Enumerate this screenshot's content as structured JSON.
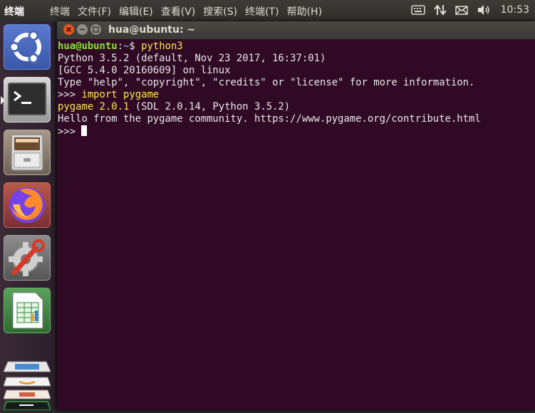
{
  "topbar": {
    "app_name": "终端",
    "menus": [
      "终端",
      "文件(F)",
      "编辑(E)",
      "查看(V)",
      "搜索(S)",
      "终端(T)",
      "帮助(H)"
    ],
    "indicators": [
      "keyboard-icon",
      "network-updown-icon",
      "mail-icon",
      "volume-icon"
    ],
    "clock": "10:53"
  },
  "launcher": {
    "items": [
      "ubuntu-dash",
      "terminal",
      "file-manager",
      "firefox",
      "system-settings",
      "libreoffice-calc",
      "stacked-apps"
    ]
  },
  "window": {
    "title": "hua@ubuntu: ~",
    "buttons": [
      "close",
      "minimize",
      "maximize"
    ]
  },
  "terminal": {
    "prompt_user": "hua@ubuntu",
    "prompt_sep": ":",
    "prompt_path": "~",
    "prompt_dollar": "$ ",
    "command": "python3",
    "line1": "Python 3.5.2 (default, Nov 23 2017, 16:37:01)",
    "line2": "[GCC 5.4.0 20160609] on linux",
    "line3": "Type \"help\", \"copyright\", \"credits\" or \"license\" for more information.",
    "repl_prompt": ">>> ",
    "repl_command": "import pygame",
    "pygame_version": "pygame 2.0.1",
    "pygame_rest": " (SDL 2.0.14, Python 3.5.2)",
    "hello": "Hello from the pygame community. https://www.pygame.org/contribute.html",
    "repl_prompt2": ">>> "
  },
  "colors": {
    "terminal_bg": "#300a24",
    "prompt_user": "#8ae234",
    "prompt_path": "#729fcf",
    "highlight": "#fce94f",
    "close_button": "#e95420"
  }
}
